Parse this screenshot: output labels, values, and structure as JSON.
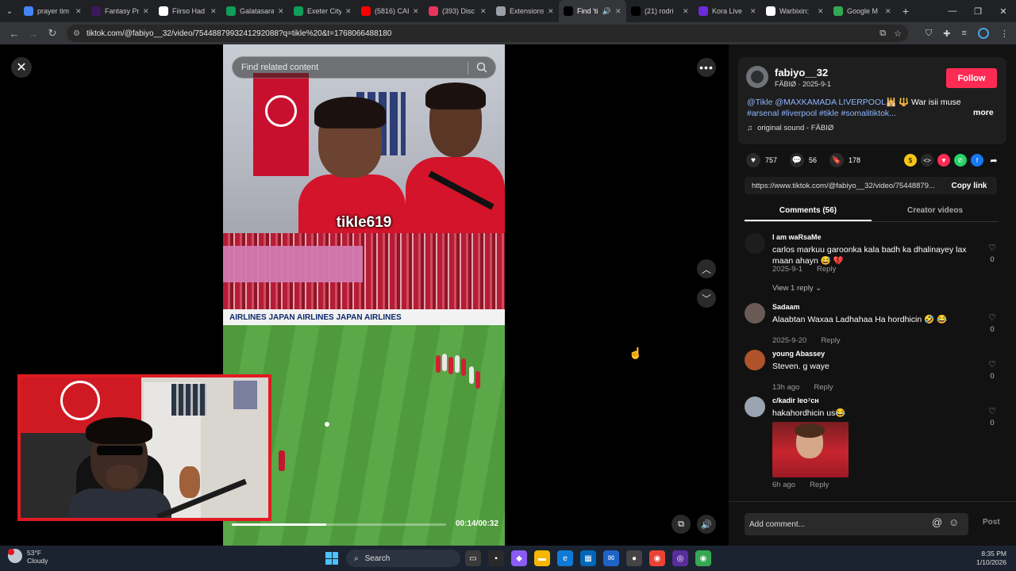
{
  "browser": {
    "tabs": [
      {
        "label": "prayer tim",
        "color": "#4285f4"
      },
      {
        "label": "Fantasy Pr",
        "color": "#3d195b"
      },
      {
        "label": "Fiirso Had",
        "color": "#ffffff"
      },
      {
        "label": "Galatasara",
        "color": "#0f9d58"
      },
      {
        "label": "Exeter City",
        "color": "#0f9d58"
      },
      {
        "label": "(5816) CAI",
        "color": "#ff0000"
      },
      {
        "label": "(393) Disc",
        "color": "#e8345d"
      },
      {
        "label": "Extensions",
        "color": "#9aa0a6"
      },
      {
        "label": "Find 'ti",
        "color": "#000000",
        "active": true
      },
      {
        "label": "(21) rodri",
        "color": "#000000"
      },
      {
        "label": "Kora Live",
        "color": "#6c2bd9"
      },
      {
        "label": "Warbixin:",
        "color": "#ffffff"
      },
      {
        "label": "Google M",
        "color": "#34a853"
      }
    ],
    "url": "tiktok.com/@fabiyo__32/video/7544887993241292088?q=tikle%20&t=1768066488180"
  },
  "video": {
    "search_placeholder": "Find related content",
    "caption_overlay": "tikle619",
    "boards_text": "AIRLINES   JAPAN AIRLINES   JAPAN AIRLINES",
    "time": "00:14/00:32",
    "progress": 0.44
  },
  "author": {
    "name": "fabiyo__32",
    "sub": "FÄBIØ · 2025-9-1",
    "follow_label": "Follow"
  },
  "post": {
    "caption_mentions": "@Tikle @MAXKAMADA LIVERPOOL",
    "caption_text": " War isii muse",
    "caption_tags": "#arsenal #liverpool #tikle #somalitiktok...",
    "more_label": "more",
    "sound": "original sound - FÄBIØ",
    "likes": "757",
    "comments": "56",
    "saves": "178",
    "link": "https://www.tiktok.com/@fabiyo__32/video/75448879...",
    "copy_label": "Copy link"
  },
  "tabs": {
    "comments": "Comments (56)",
    "creator": "Creator videos"
  },
  "comments": [
    {
      "user": "I am waRsaMe",
      "text": "carlos markuu garoonka kala badh ka dhalinayey lax maan ahayn 😅 💔",
      "date": "2025-9-1",
      "reply": "Reply",
      "likes": "0",
      "view_replies": "View 1 reply ⌄",
      "avatar_color": "#1d1d1d"
    },
    {
      "user": "Sadaam",
      "text": "Alaabtan Waxaa Ladhahaa Ha hordhicin 🤣 😂",
      "date": "2025-9-20",
      "reply": "Reply",
      "likes": "0",
      "avatar_color": "#6a5a55"
    },
    {
      "user": "young Abassey",
      "text": "Steven. g waye",
      "date": "13h ago",
      "reply": "Reply",
      "likes": "0",
      "avatar_color": "#b0532b"
    },
    {
      "user": "c/kadir leo⁷ᴄʜ",
      "text": "hakahordhicin us😂",
      "date": "6h ago",
      "reply": "Reply",
      "likes": "0",
      "avatar_color": "#9aa4b0"
    }
  ],
  "composer": {
    "placeholder": "Add comment...",
    "post_label": "Post"
  },
  "taskbar": {
    "temp": "53°F",
    "weather": "Cloudy",
    "search": "Search",
    "time": "8:35 PM",
    "date": "1/10/2026"
  }
}
